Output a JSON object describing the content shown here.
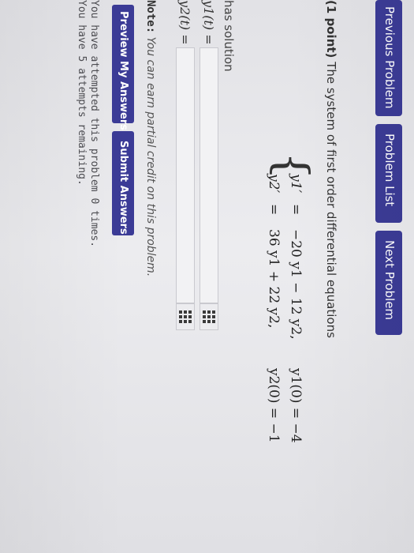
{
  "nav": {
    "previous_label": "Previous Problem",
    "list_label": "Problem List",
    "next_label": "Next Problem"
  },
  "problem": {
    "points": "(1 point)",
    "statement": "The system of first order differential equations",
    "equations": [
      {
        "lhs": "y1′",
        "sign": "=",
        "rhs": "−20 y1 − 12 y2,",
        "initial": "y1(0) = −4"
      },
      {
        "lhs": "y2′",
        "sign": "=",
        "rhs": "36 y1 + 22 y2,",
        "initial": "y2(0) = −1"
      }
    ],
    "has_solution": "has solution"
  },
  "answers": [
    {
      "label": "y1(t) =",
      "value": "",
      "icon": "equation-editor-icon"
    },
    {
      "label": "y2(t) =",
      "value": "",
      "icon": "equation-editor-icon"
    }
  ],
  "note": {
    "label": "Note:",
    "text": "You can earn partial credit on this problem."
  },
  "actions": {
    "preview_label": "Preview My Answers",
    "submit_label": "Submit Answers"
  },
  "attempts": {
    "line1": "You have attempted this problem 0 times.",
    "line2": "You have 5 attempts remaining."
  },
  "colors": {
    "button": "#3b3b96",
    "background": "#e6e6ea"
  }
}
